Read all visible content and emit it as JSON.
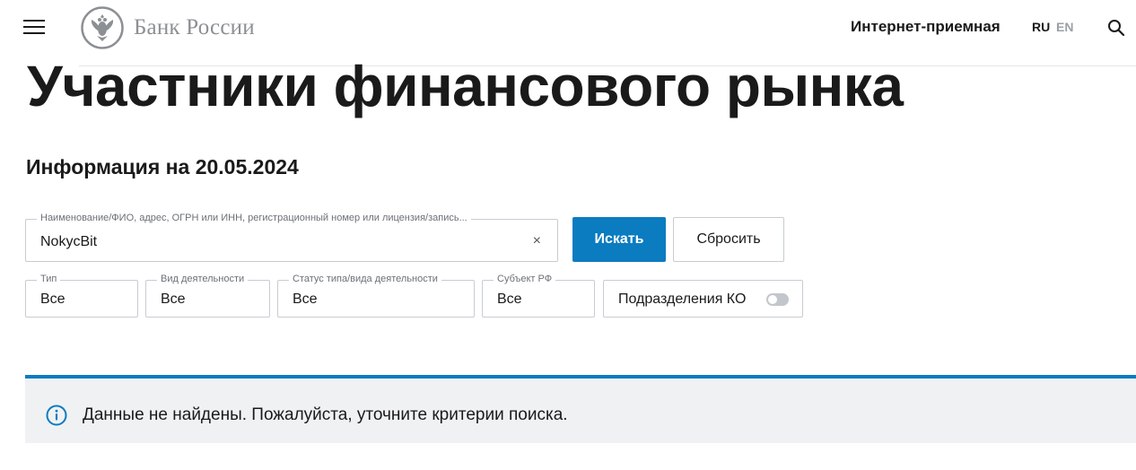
{
  "header": {
    "logo_text": "Банк России",
    "reception_link": "Интернет-приемная",
    "lang_ru": "RU",
    "lang_en": "EN",
    "icons": [
      "menu-icon",
      "bank-emblem-icon",
      "search-icon"
    ]
  },
  "page": {
    "title": "Участники финансового рынка",
    "info_date": "Информация на 20.05.2024"
  },
  "search": {
    "label": "Наименование/ФИО, адрес, ОГРН или ИНН, регистрационный номер или лицензия/запись...",
    "value": "NokycBit",
    "clear": "×",
    "search_button": "Искать",
    "reset_button": "Сбросить"
  },
  "filters": {
    "type": {
      "label": "Тип",
      "value": "Все"
    },
    "activity": {
      "label": "Вид деятельности",
      "value": "Все"
    },
    "status": {
      "label": "Статус типа/вида деятельности",
      "value": "Все"
    },
    "subject": {
      "label": "Субъект РФ",
      "value": "Все"
    },
    "branches_toggle": {
      "label": "Подразделения КО",
      "enabled": false
    }
  },
  "notice": {
    "text": "Данные не найдены. Пожалуйста, уточните критерии поиска."
  },
  "colors": {
    "accent": "#0b7cc0",
    "notice_bg": "#f0f1f3",
    "logo_gray": "#8c9094",
    "border": "#c8ccd1"
  }
}
